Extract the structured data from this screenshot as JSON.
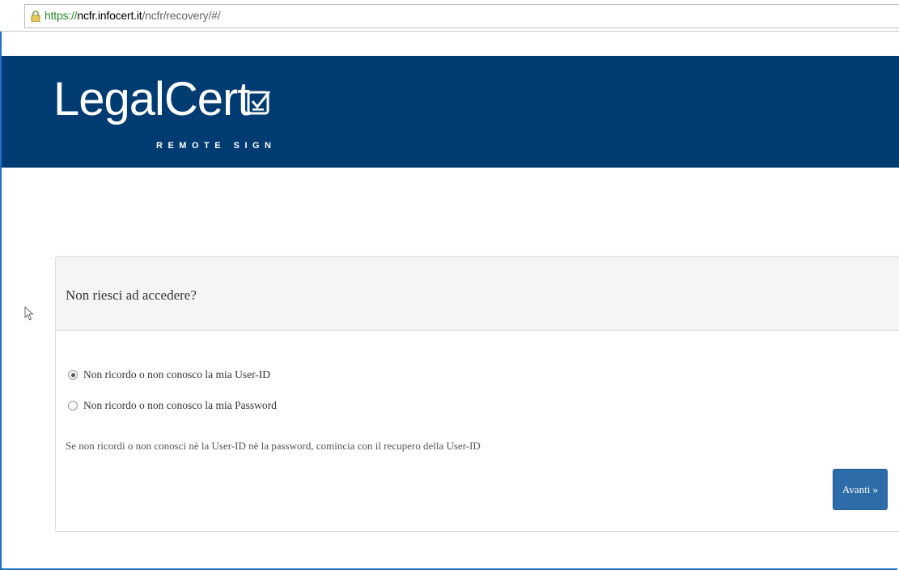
{
  "browser": {
    "url_scheme": "https://",
    "url_host": "ncfr.infocert.it",
    "url_path": "/ncfr/recovery/#/"
  },
  "header": {
    "logo_text": "LegalCert",
    "logo_subtitle": "REMOTE SIGN",
    "background": "#003b72"
  },
  "panel": {
    "title": "Non riesci ad accedere?",
    "options": [
      {
        "label": "Non ricordo o non conosco la mia User-ID",
        "selected": true
      },
      {
        "label": "Non ricordo o non conosco la mia Password",
        "selected": false
      }
    ],
    "note": "Se non ricordi o non conosci nè la User-ID nè la password, comincia con il recupero della User-ID",
    "next_button": "Avanti »"
  },
  "colors": {
    "accent": "#2d6ca8",
    "frame": "#1f6fc5"
  }
}
